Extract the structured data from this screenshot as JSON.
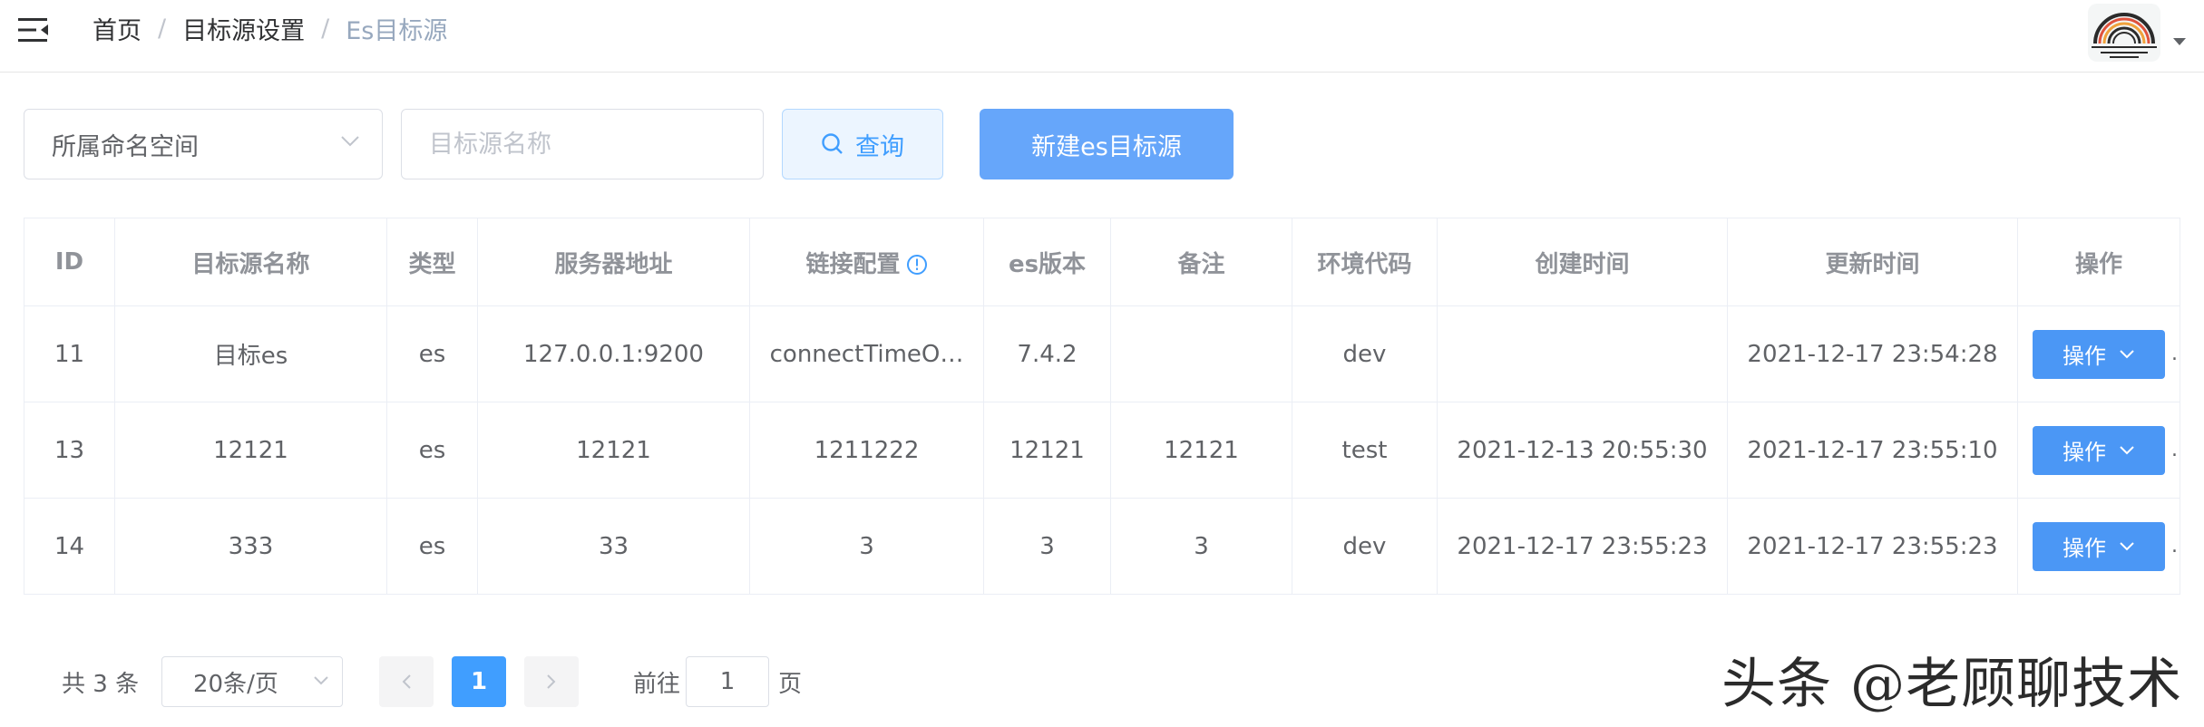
{
  "breadcrumb": {
    "items": [
      "首页",
      "目标源设置"
    ],
    "current": "Es目标源",
    "separator": "/"
  },
  "filter": {
    "namespace_select": "所属命名空间",
    "name_placeholder": "目标源名称",
    "query_label": "查询",
    "new_label": "新建es目标源"
  },
  "table": {
    "headers": [
      "ID",
      "目标源名称",
      "类型",
      "服务器地址",
      "链接配置",
      "es版本",
      "备注",
      "环境代码",
      "创建时间",
      "更新时间",
      "操作"
    ],
    "rows": [
      {
        "id": "11",
        "name": "目标es",
        "type": "es",
        "server": "127.0.0.1:9200",
        "config": "connectTimeO…",
        "version": "7.4.2",
        "remark": "",
        "env": "dev",
        "created": "",
        "updated": "2021-12-17 23:54:28",
        "action": "操作"
      },
      {
        "id": "13",
        "name": "12121",
        "type": "es",
        "server": "12121",
        "config": "1211222",
        "version": "12121",
        "remark": "12121",
        "env": "test",
        "created": "2021-12-13 20:55:30",
        "updated": "2021-12-17 23:55:10",
        "action": "操作"
      },
      {
        "id": "14",
        "name": "333",
        "type": "es",
        "server": "33",
        "config": "3",
        "version": "3",
        "remark": "3",
        "env": "dev",
        "created": "2021-12-17 23:55:23",
        "updated": "2021-12-17 23:55:23",
        "action": "操作"
      }
    ],
    "overflow_marker": "."
  },
  "pagination": {
    "total": "共 3 条",
    "page_size": "20条/页",
    "current_page": "1",
    "goto_label": "前往",
    "goto_value": "1",
    "page_unit": "页"
  },
  "watermark": "头条 @老顾聊技术",
  "colors": {
    "primary": "#409eff",
    "primary_button": "#66a6fa",
    "op_button": "#4b97f5",
    "query_bg": "#ecf5ff",
    "query_border": "#b3d8ff",
    "border": "#dcdfe6",
    "text": "#606266",
    "header_text": "#909399"
  },
  "icons": {
    "menu": "hamburger-icon",
    "search": "search-icon",
    "info": "info-circle-icon",
    "dropdown": "chevron-down-icon",
    "prev": "chevron-left-icon",
    "next": "chevron-right-icon"
  }
}
